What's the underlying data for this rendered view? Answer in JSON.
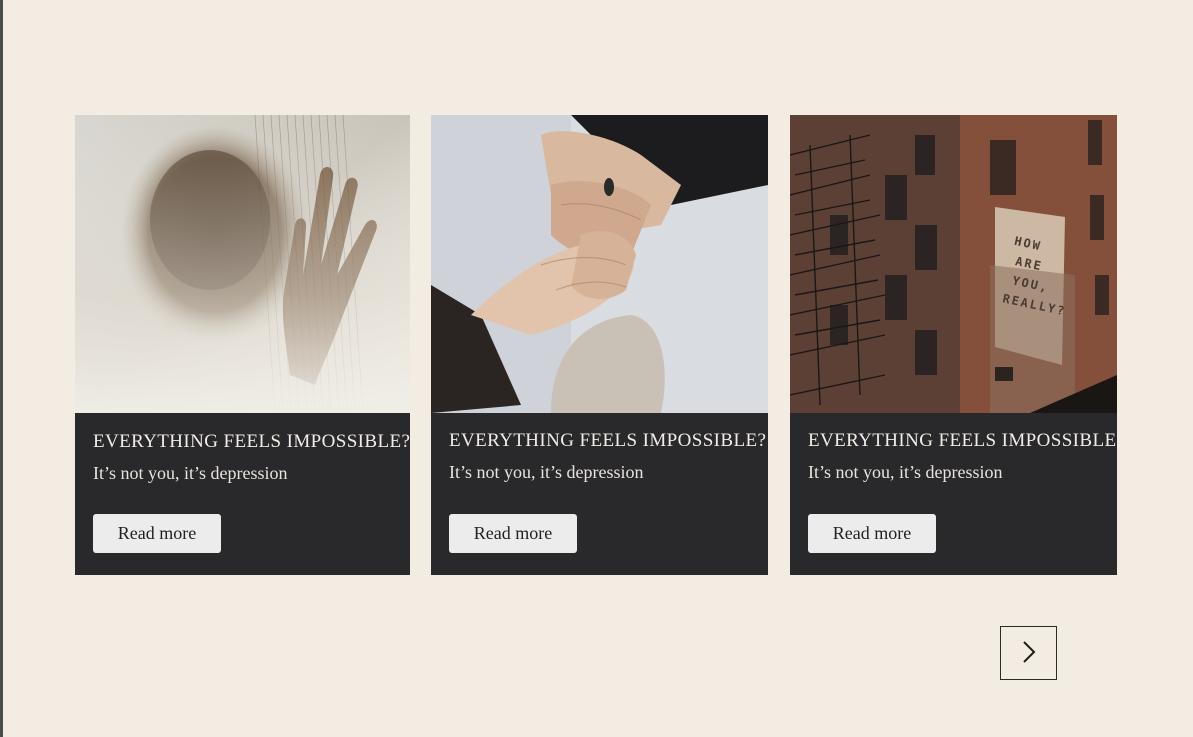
{
  "cards": [
    {
      "image_alt": "blurred hand behind sheer curtain",
      "title": "EVERYTHING FEELS IMPOSSIBLE?",
      "subtitle": "It’s not you, it’s depression",
      "button_label": "Read more"
    },
    {
      "image_alt": "hands holding together",
      "title": "EVERYTHING FEELS IMPOSSIBLE?",
      "subtitle": "It’s not you, it’s depression",
      "button_label": "Read more"
    },
    {
      "image_alt": "brick building with mural",
      "mural_text": "HOW ARE YOU, REALLY?",
      "title": "EVERYTHING FEELS IMPOSSIBLE?",
      "subtitle": "It’s not you, it’s depression",
      "button_label": "Read more"
    }
  ],
  "carousel": {
    "next_icon": "chevron-right-icon"
  },
  "colors": {
    "page_background": "#f3ece2",
    "card_background": "#29292b",
    "button_background": "#ececec"
  }
}
